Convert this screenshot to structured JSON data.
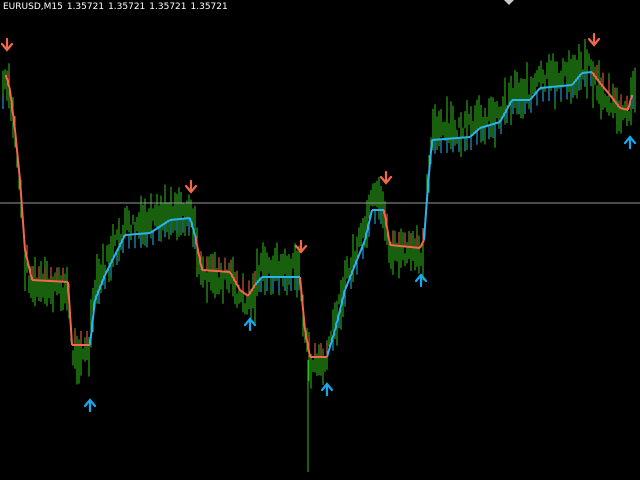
{
  "header": {
    "symbol_timeframe": "EURUSD,M15",
    "quotes": [
      "1.35721",
      "1.35721",
      "1.35721",
      "1.35721"
    ]
  },
  "colors": {
    "background": "#000000",
    "candles": "#2fc01a",
    "trend_up": "#2bb3ea",
    "trend_down": "#f2684a",
    "arrow_up": "#17a8ee",
    "arrow_down": "#f2684a",
    "price_line": "#9a9a9a",
    "header_text": "#ffffff"
  },
  "icons": {
    "buy_signal": "arrow-up-icon",
    "sell_signal": "arrow-down-icon"
  }
}
